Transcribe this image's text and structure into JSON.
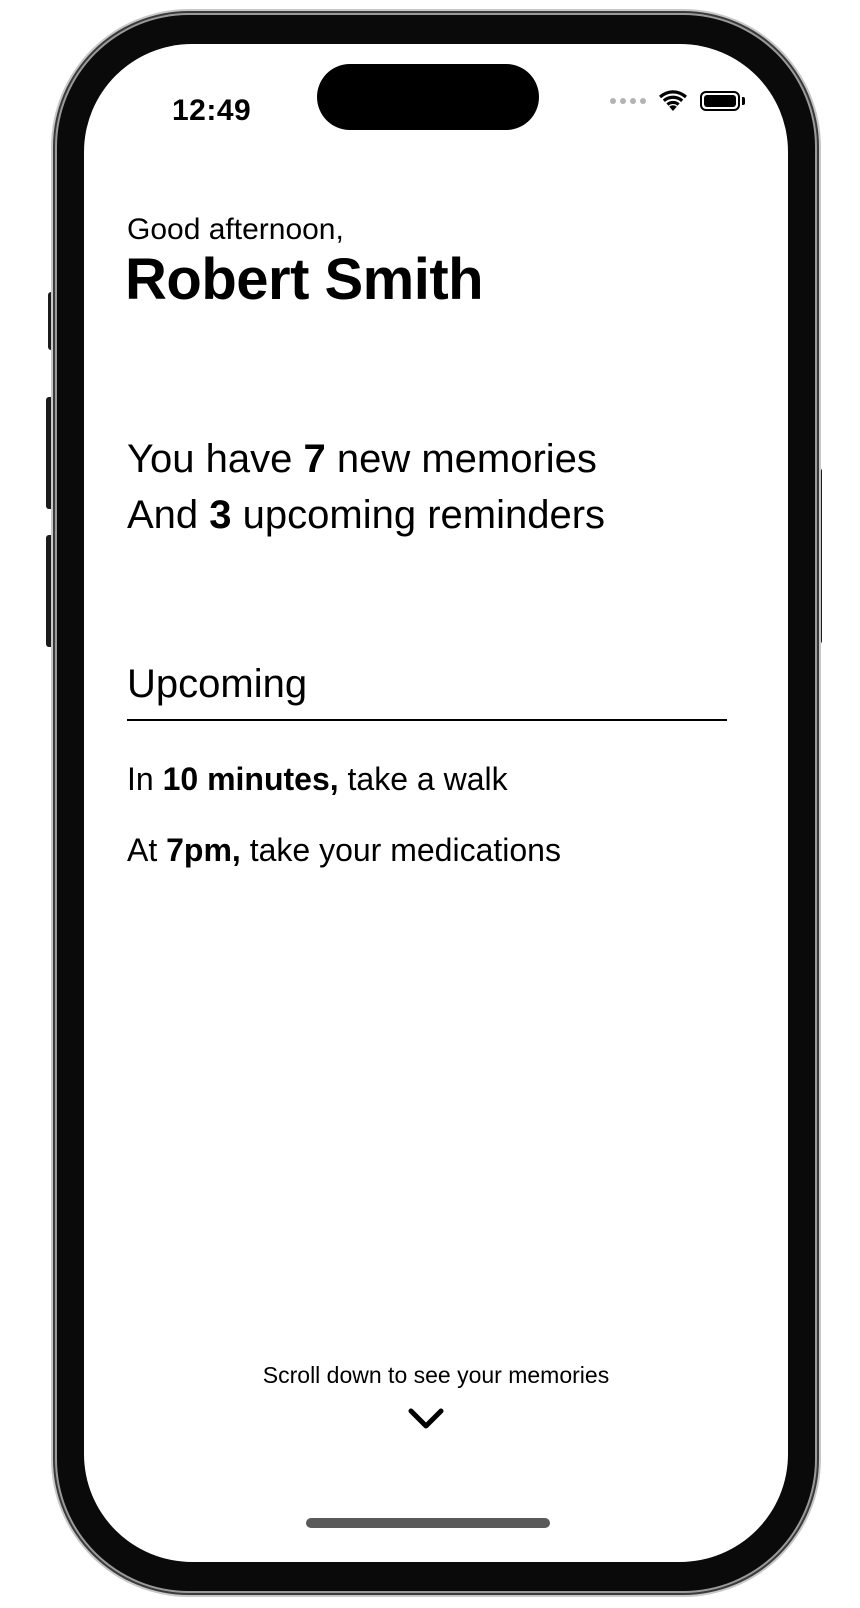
{
  "status_bar": {
    "time": "12:49",
    "icons": [
      "cellular-signal-icon",
      "wifi-icon",
      "battery-icon"
    ]
  },
  "header": {
    "greeting": "Good afternoon,",
    "user_name": "Robert Smith"
  },
  "summary": {
    "memories": {
      "prefix": "You have ",
      "count": "7",
      "suffix": " new memories"
    },
    "reminders": {
      "prefix": "And ",
      "count": "3",
      "suffix": " upcoming reminders"
    }
  },
  "upcoming": {
    "title": "Upcoming",
    "items": [
      {
        "prefix": "In ",
        "highlight": "10 minutes,",
        "suffix": " take a walk"
      },
      {
        "prefix": "At ",
        "highlight": "7pm,",
        "suffix": " take your medications"
      }
    ]
  },
  "footer": {
    "scroll_hint": "Scroll down to see your memories",
    "scroll_icon": "chevron-down-icon"
  }
}
